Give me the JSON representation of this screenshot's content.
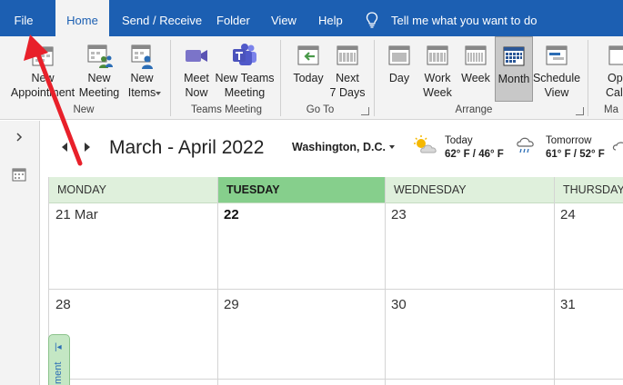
{
  "tabs": [
    {
      "label": "File",
      "active": false
    },
    {
      "label": "Home",
      "active": true
    },
    {
      "label": "Send / Receive",
      "active": false
    },
    {
      "label": "Folder",
      "active": false
    },
    {
      "label": "View",
      "active": false
    },
    {
      "label": "Help",
      "active": false
    }
  ],
  "tell_me": "Tell me what you want to do",
  "ribbon": {
    "new_group": {
      "label": "New",
      "buttons": [
        {
          "label_1": "New",
          "label_2": "Appointment",
          "icon": "calendar-new-icon"
        },
        {
          "label_1": "New",
          "label_2": "Meeting",
          "icon": "meeting-icon"
        },
        {
          "label_1": "New",
          "label_2": "Items",
          "icon": "new-items-icon"
        }
      ]
    },
    "teams_group": {
      "label": "Teams Meeting",
      "buttons": [
        {
          "label_1": "Meet",
          "label_2": "Now",
          "icon": "video-camera-icon"
        },
        {
          "label_1": "New Teams",
          "label_2": "Meeting",
          "icon": "teams-icon"
        }
      ]
    },
    "goto_group": {
      "label": "Go To",
      "buttons": [
        {
          "label_1": "Today",
          "label_2": "",
          "icon": "today-icon"
        },
        {
          "label_1": "Next",
          "label_2": "7 Days",
          "icon": "next-7-days-icon"
        }
      ]
    },
    "arrange_group": {
      "label": "Arrange",
      "buttons": [
        {
          "label_1": "Day",
          "label_2": "",
          "icon": "day-view-icon"
        },
        {
          "label_1": "Work",
          "label_2": "Week",
          "icon": "work-week-icon"
        },
        {
          "label_1": "Week",
          "label_2": "",
          "icon": "week-view-icon"
        },
        {
          "label_1": "Month",
          "label_2": "",
          "icon": "month-view-icon",
          "selected": true
        },
        {
          "label_1": "Schedule",
          "label_2": "View",
          "icon": "schedule-view-icon"
        }
      ]
    },
    "cut_group": {
      "label": "Ma",
      "buttons": [
        {
          "label_1": "Op",
          "label_2": "Cale",
          "icon": "open-calendar-icon"
        }
      ]
    }
  },
  "calendar": {
    "date_range": "March - April 2022",
    "location": "Washington,  D.C.",
    "weather": {
      "today_label": "Today",
      "today_temp": "62° F / 46° F",
      "tomorrow_label": "Tomorrow",
      "tomorrow_temp": "61° F / 52° F"
    },
    "weekdays": [
      "MONDAY",
      "TUESDAY",
      "WEDNESDAY",
      "THURSDAY"
    ],
    "weeks": [
      [
        "21 Mar",
        "22",
        "23",
        "24"
      ],
      [
        "28",
        "29",
        "30",
        "31"
      ]
    ],
    "today_index": 1,
    "peek_label": "ment"
  },
  "colors": {
    "accent": "#1c5fb2",
    "ribbon_bg": "#f3f3f3",
    "day_header": "#dff0dc",
    "today_header": "#86cf8c",
    "annotation_arrow": "#e8202a"
  }
}
